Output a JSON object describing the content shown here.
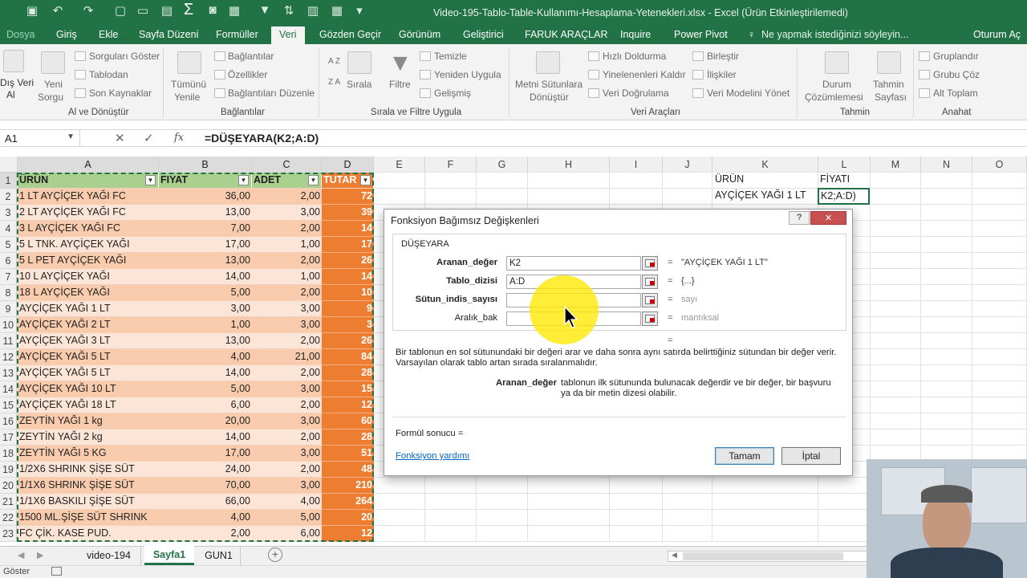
{
  "window": {
    "title": "Video-195-Tablo-Table-Kullanımı-Hesaplama-Yetenekleri.xlsx - Excel (Ürün Etkinleştirilemedi)"
  },
  "ribbon_tabs": [
    "Dosya",
    "Giriş",
    "Ekle",
    "Sayfa Düzeni",
    "Formüller",
    "Veri",
    "Gözden Geçir",
    "Görünüm",
    "Geliştirici",
    "FARUK ARAÇLAR",
    "Inquire",
    "Power Pivot"
  ],
  "tell_me": "Ne yapmak istediğinizi söyleyin...",
  "sign_in": "Oturum Aç",
  "ribbon": {
    "dis_veri": "Dış Veri",
    "al": "Al",
    "yeni": "Yeni",
    "sorgu": "Sorgu",
    "sorgulari_goster": "Sorguları Göster",
    "tablodan": "Tablodan",
    "son_kaynaklar": "Son Kaynaklar",
    "al_ve_donustur": "Al ve Dönüştür",
    "tumunu": "Tümünü",
    "yenile": "Yenile",
    "baglantilar": "Bağlantılar",
    "ozellikler": "Özellikler",
    "baglantilari_duzenle": "Bağlantıları Düzenle",
    "baglantilar_group": "Bağlantılar",
    "az": "A Z",
    "za": "Z A",
    "sirala": "Sırala",
    "filtre": "Filtre",
    "temizle": "Temizle",
    "yeniden_uygula": "Yeniden Uygula",
    "gelismis": "Gelişmiş",
    "sirala_filtre_group": "Sırala ve Filtre Uygula",
    "metni_sutunlara": "Metni Sütunlara",
    "donustur": "Dönüştür",
    "hizli_doldurma": "Hızlı Doldurma",
    "yinelenenleri_kaldir": "Yinelenenleri Kaldır",
    "veri_dogrulama": "Veri Doğrulama",
    "birlestir": "Birleştir",
    "iliskiler": "İlişkiler",
    "veri_modelini_yonet": "Veri Modelini Yönet",
    "veri_araclari_group": "Veri Araçları",
    "durum": "Durum",
    "cozumlemesi": "Çözümlemesi",
    "tahmin": "Tahmin",
    "sayfasi": "Sayfası",
    "tahmin_group": "Tahmin",
    "gruplandir": "Gruplandır",
    "grubu_coz": "Grubu Çöz",
    "alt_toplam": "Alt Toplam",
    "anahat_group": "Anahat"
  },
  "formula_bar": {
    "name_box": "A1",
    "fx": "fx",
    "formula": "=DÜŞEYARA(K2;A:D)"
  },
  "columns": [
    "A",
    "B",
    "C",
    "D",
    "E",
    "F",
    "G",
    "H",
    "I",
    "J",
    "K",
    "L",
    "M",
    "N",
    "O"
  ],
  "table": {
    "headers": [
      "ÜRÜN",
      "FIYAT",
      "ADET",
      "TUTAR"
    ],
    "rows": [
      [
        "1 LT AYÇİÇEK YAĞI FC",
        "36,00",
        "2,00",
        "72"
      ],
      [
        "2 LT AYÇİÇEK YAĞI FC",
        "13,00",
        "3,00",
        "39"
      ],
      [
        "3 L AYÇİÇEK YAĞI FC",
        "7,00",
        "2,00",
        "14"
      ],
      [
        "5 L TNK. AYÇİÇEK YAĞI",
        "17,00",
        "1,00",
        "17"
      ],
      [
        "5 L PET AYÇİÇEK YAĞI",
        "13,00",
        "2,00",
        "26"
      ],
      [
        "10 L AYÇİÇEK YAĞI",
        "14,00",
        "1,00",
        "14"
      ],
      [
        "18 L AYÇİÇEK YAĞI",
        "5,00",
        "2,00",
        "10"
      ],
      [
        "AYÇİÇEK YAĞI 1 LT",
        "3,00",
        "3,00",
        "9"
      ],
      [
        "AYÇİÇEK YAĞI 2 LT",
        "1,00",
        "3,00",
        "3"
      ],
      [
        "AYÇİÇEK YAĞI 3 LT",
        "13,00",
        "2,00",
        "26"
      ],
      [
        "AYÇİÇEK YAĞI 5 LT",
        "4,00",
        "21,00",
        "84"
      ],
      [
        "AYÇİÇEK YAĞI 5 LT",
        "14,00",
        "2,00",
        "28"
      ],
      [
        "AYÇİÇEK YAĞI 10 LT",
        "5,00",
        "3,00",
        "15"
      ],
      [
        "AYÇİÇEK YAĞI 18 LT",
        "6,00",
        "2,00",
        "12"
      ],
      [
        "ZEYTİN YAĞI 1 kg",
        "20,00",
        "3,00",
        "60"
      ],
      [
        "ZEYTİN YAĞI 2 kg",
        "14,00",
        "2,00",
        "28"
      ],
      [
        "ZEYTİN YAĞI 5 KG",
        "17,00",
        "3,00",
        "51"
      ],
      [
        "1/2X6 SHRINK ŞİŞE SÜT",
        "24,00",
        "2,00",
        "48"
      ],
      [
        "1/1X6 SHRINK ŞİŞE SÜT",
        "70,00",
        "3,00",
        "210"
      ],
      [
        "1/1X6 BASKILI ŞİŞE SÜT",
        "66,00",
        "4,00",
        "264"
      ],
      [
        "1500 ML.ŞİŞE SÜT SHRINK",
        "4,00",
        "5,00",
        "20"
      ],
      [
        "FC  ÇİK. KASE PUD.",
        "2,00",
        "6,00",
        "12"
      ]
    ]
  },
  "lookup": {
    "k1": "ÜRÜN",
    "l1": "FİYATI",
    "k2": "AYÇİÇEK YAĞI 1 LT",
    "l2": "K2;A:D)"
  },
  "dialog": {
    "title": "Fonksiyon Bağımsız Değişkenleri",
    "help": "?",
    "close": "✕",
    "function_name": "DÜŞEYARA",
    "args": [
      {
        "label": "Aranan_değer",
        "value": "K2",
        "result": "\"AYÇİÇEK YAĞI 1 LT\"",
        "bold": true
      },
      {
        "label": "Tablo_dizisi",
        "value": "A:D",
        "result": "{...}",
        "bold": true
      },
      {
        "label": "Sütun_indis_sayısı",
        "value": "",
        "result": "sayı",
        "bold": true
      },
      {
        "label": "Aralık_bak",
        "value": "",
        "result": "mantıksal",
        "bold": false
      }
    ],
    "eq": "=",
    "description": "Bir tablonun en sol sütunundaki bir değeri arar ve daha sonra aynı satırda belirttiğiniz sütundan bir değer verir. Varsayılan olarak tablo artan sırada sıralanmalıdır.",
    "arg_help_label": "Aranan_değer",
    "arg_help_text": "tablonun ilk sütununda bulunacak değerdir ve bir değer, bir başvuru ya da bir metin dizesi olabilir.",
    "formula_result": "Formül sonucu =",
    "help_link": "Fonksiyon yardımı",
    "ok": "Tamam",
    "cancel": "İptal"
  },
  "sheets": [
    "video-194",
    "Sayfa1",
    "GUN1"
  ],
  "active_sheet": "Sayfa1",
  "status": "Göster",
  "colors": {
    "excel_green": "#217346",
    "header_row": "#a9d08e",
    "row_light": "#fce4d6",
    "row_dark": "#f8cbad",
    "tutar": "#ed7d31",
    "highlight": "#ffeb00"
  }
}
